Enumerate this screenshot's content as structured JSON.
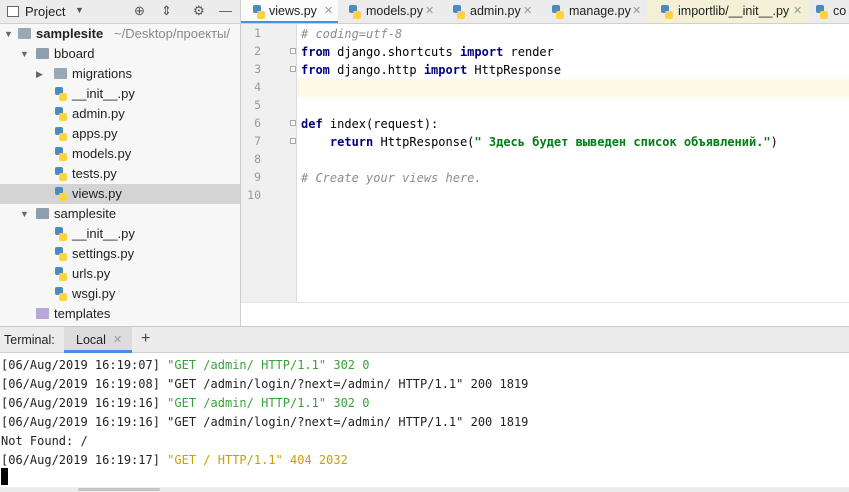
{
  "project_panel": {
    "title": "Project",
    "tree": [
      {
        "label": "samplesite",
        "path": "~/Desktop/проекты/",
        "kind": "folder",
        "expanded": true
      },
      {
        "label": "bboard",
        "kind": "package",
        "expanded": true
      },
      {
        "label": "migrations",
        "kind": "folder",
        "expanded": false
      },
      {
        "label": "__init__.py",
        "kind": "py"
      },
      {
        "label": "admin.py",
        "kind": "py"
      },
      {
        "label": "apps.py",
        "kind": "py"
      },
      {
        "label": "models.py",
        "kind": "py"
      },
      {
        "label": "tests.py",
        "kind": "py"
      },
      {
        "label": "views.py",
        "kind": "py",
        "selected": true
      },
      {
        "label": "samplesite",
        "kind": "package",
        "expanded": true
      },
      {
        "label": "__init__.py",
        "kind": "py"
      },
      {
        "label": "settings.py",
        "kind": "py"
      },
      {
        "label": "urls.py",
        "kind": "py"
      },
      {
        "label": "wsgi.py",
        "kind": "py"
      },
      {
        "label": "templates",
        "kind": "folder-purple"
      }
    ]
  },
  "editor_tabs": [
    {
      "label": "views.py",
      "active": true
    },
    {
      "label": "models.py"
    },
    {
      "label": "admin.py"
    },
    {
      "label": "manage.py"
    },
    {
      "label": "importlib/__init__.py",
      "library": true
    },
    {
      "label": "co"
    }
  ],
  "editor": {
    "line_numbers": [
      "1",
      "2",
      "3",
      "4",
      "5",
      "6",
      "7",
      "8",
      "9",
      "10"
    ],
    "lines": {
      "l1": "# coding=utf-8",
      "l2_kw1": "from",
      "l2_mod": " django.shortcuts ",
      "l2_kw2": "import",
      "l2_name": " render",
      "l3_kw1": "from",
      "l3_mod": " django.http ",
      "l3_kw2": "import",
      "l3_name": " HttpResponse",
      "l6_kw": "def",
      "l6_rest": " index(request):",
      "l7_indent": "    ",
      "l7_kw": "return",
      "l7_call": " HttpResponse(",
      "l7_str": "\" Здесь будет выведен список объявлений.\"",
      "l7_end": ")",
      "l9": "# Create your views here."
    }
  },
  "terminal": {
    "label": "Terminal:",
    "tab": "Local",
    "add": "+",
    "lines": [
      {
        "prefix": "[06/Aug/2019 16:19:07] ",
        "text": "\"GET /admin/ HTTP/1.1\" 302 0",
        "color": "green"
      },
      {
        "prefix": "[06/Aug/2019 16:19:08] ",
        "text": "\"GET /admin/login/?next=/admin/ HTTP/1.1\" 200 1819",
        "color": "default"
      },
      {
        "prefix": "[06/Aug/2019 16:19:16] ",
        "text": "\"GET /admin/ HTTP/1.1\" 302 0",
        "color": "green"
      },
      {
        "prefix": "[06/Aug/2019 16:19:16] ",
        "text": "\"GET /admin/login/?next=/admin/ HTTP/1.1\" 200 1819",
        "color": "default"
      },
      {
        "prefix": "Not Found: /",
        "text": "",
        "color": "default"
      },
      {
        "prefix": "[06/Aug/2019 16:19:17] ",
        "text": "\"GET / HTTP/1.1\" 404 2032",
        "color": "amber"
      }
    ]
  },
  "colors": {
    "accent": "#4a8fdb",
    "keyword": "#000080",
    "string": "#067d17",
    "comment": "#8c8c8c",
    "terminal_green": "#3aa13a",
    "terminal_amber": "#c9a000"
  }
}
